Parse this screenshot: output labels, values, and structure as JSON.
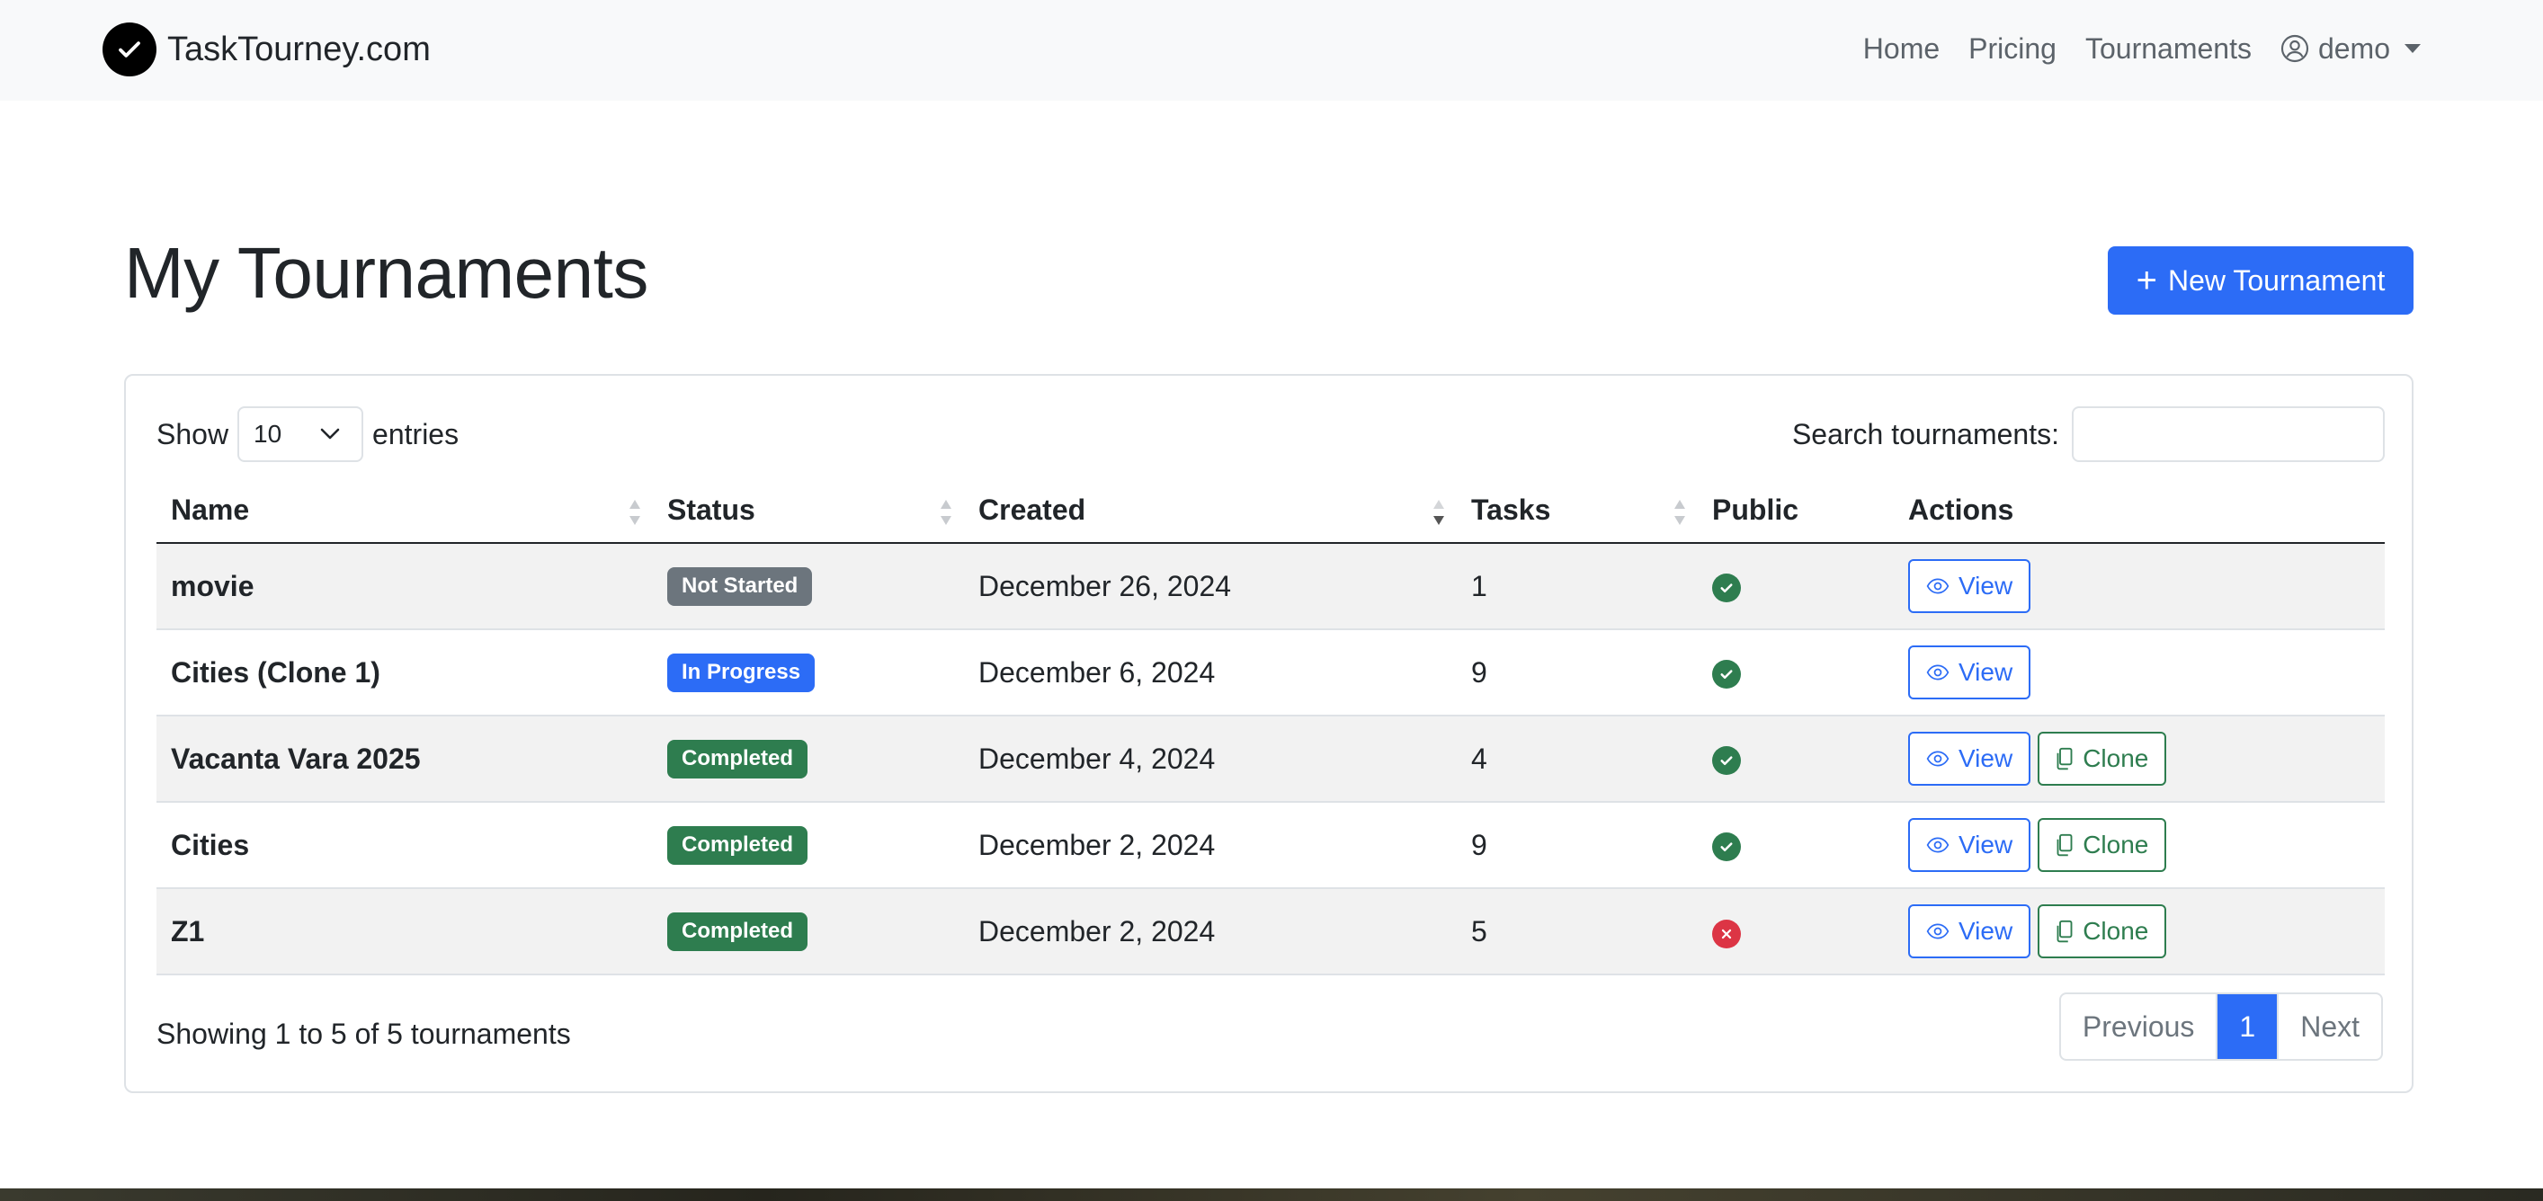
{
  "navbar": {
    "brand": "TaskTourney.com",
    "links": [
      "Home",
      "Pricing",
      "Tournaments"
    ],
    "user": "demo"
  },
  "page": {
    "title": "My Tournaments",
    "new_button": "New Tournament"
  },
  "table_controls": {
    "show_label": "Show",
    "page_length": "10",
    "entries_label": "entries",
    "search_label": "Search tournaments:",
    "search_value": ""
  },
  "table": {
    "columns": [
      "Name",
      "Status",
      "Created",
      "Tasks",
      "Public",
      "Actions"
    ],
    "rows": [
      {
        "name": "movie",
        "status": "Not Started",
        "created": "December 26, 2024",
        "tasks": "1",
        "public": true,
        "actions": [
          "View"
        ]
      },
      {
        "name": "Cities (Clone 1)",
        "status": "In Progress",
        "created": "December 6, 2024",
        "tasks": "9",
        "public": true,
        "actions": [
          "View"
        ]
      },
      {
        "name": "Vacanta Vara 2025",
        "status": "Completed",
        "created": "December 4, 2024",
        "tasks": "4",
        "public": true,
        "actions": [
          "View",
          "Clone"
        ]
      },
      {
        "name": "Cities",
        "status": "Completed",
        "created": "December 2, 2024",
        "tasks": "9",
        "public": true,
        "actions": [
          "View",
          "Clone"
        ]
      },
      {
        "name": "Z1",
        "status": "Completed",
        "created": "December 2, 2024",
        "tasks": "5",
        "public": false,
        "actions": [
          "View",
          "Clone"
        ]
      }
    ]
  },
  "status_colors": {
    "Not Started": "#6c757d",
    "In Progress": "#2c6cf6",
    "Completed": "#2e7d4f"
  },
  "footer": {
    "info": "Showing 1 to 5 of 5 tournaments",
    "previous": "Previous",
    "current_page": "1",
    "next": "Next"
  }
}
